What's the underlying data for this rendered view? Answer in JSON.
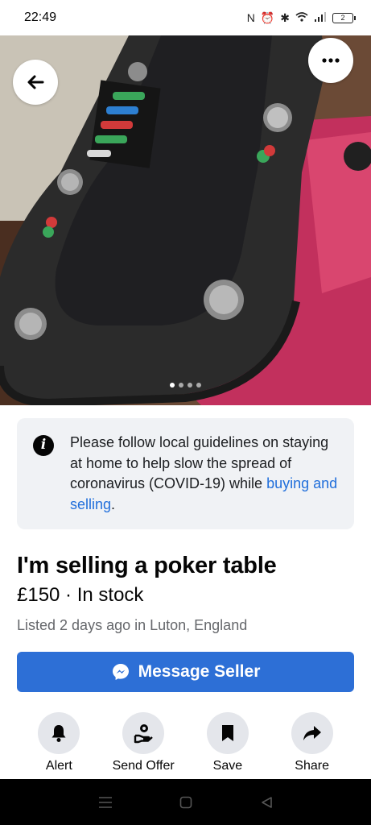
{
  "status_bar": {
    "time": "22:49",
    "icons": [
      "nfc-icon",
      "alarm-icon",
      "bluetooth-icon",
      "wifi-icon",
      "signal-icon",
      "battery-icon"
    ],
    "battery_level": "2"
  },
  "photo": {
    "carousel_total": 4,
    "carousel_active": 1,
    "back_icon": "back-arrow-icon",
    "more_icon": "more-icon"
  },
  "notice": {
    "text": "Please follow local guidelines on staying at home to help slow the spread of coronavirus (COVID-19) while ",
    "link": "buying and selling",
    "end": "."
  },
  "listing": {
    "title": "I'm selling a poker table",
    "price": "£150",
    "separator": " · ",
    "stock": "In stock",
    "listed": "Listed 2 days ago in Luton, England"
  },
  "message_button": {
    "label": "Message Seller",
    "icon": "messenger-icon"
  },
  "actions": [
    {
      "label": "Alert",
      "icon": "bell-icon"
    },
    {
      "label": "Send Offer",
      "icon": "offer-icon"
    },
    {
      "label": "Save",
      "icon": "bookmark-icon"
    },
    {
      "label": "Share",
      "icon": "share-icon"
    }
  ],
  "nav_bar": {
    "icons": [
      "menu-icon",
      "home-icon",
      "back-icon"
    ]
  },
  "colors": {
    "accent": "#2d6fd6",
    "link": "#216fdb",
    "notice_bg": "#f0f2f5",
    "button_bg": "#e4e6eb"
  }
}
